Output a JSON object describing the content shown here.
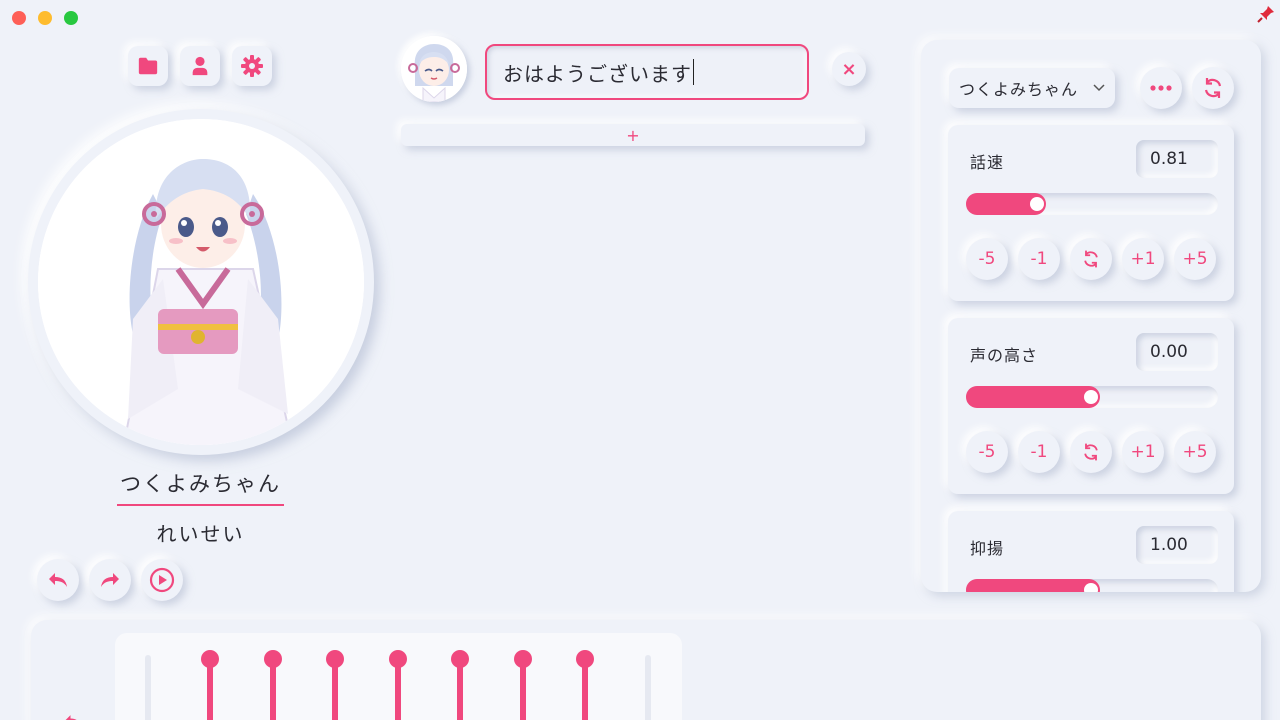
{
  "window": {
    "controls": [
      "close",
      "minimize",
      "maximize"
    ]
  },
  "toolbar": {
    "icons": [
      "folder-icon",
      "user-icon",
      "gear-icon"
    ]
  },
  "character": {
    "name": "つくよみちゃん",
    "style": "れいせい"
  },
  "editor": {
    "text": "おはようございます",
    "add_label": "+",
    "clear_label": "×"
  },
  "panel": {
    "speaker": "つくよみちゃん",
    "parameters": [
      {
        "label": "話速",
        "value": "0.81",
        "level": 0.27
      },
      {
        "label": "声の高さ",
        "value": "0.00",
        "level": 0.5
      },
      {
        "label": "抑揚",
        "value": "1.00",
        "level": 0.5
      }
    ],
    "steps": [
      "-5",
      "-1",
      "reset",
      "+1",
      "+5"
    ]
  },
  "colors": {
    "accent": "#f0487e",
    "background": "#eff2f9"
  }
}
